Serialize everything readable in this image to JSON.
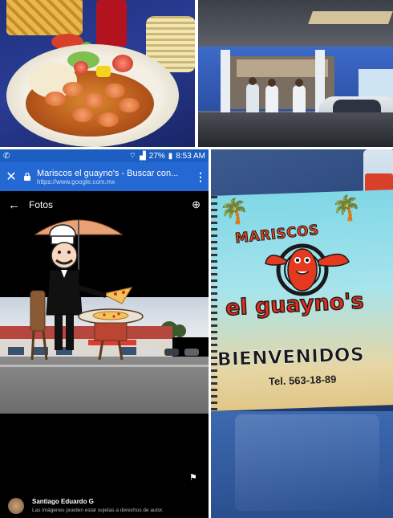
{
  "phone": {
    "status_left": "✆",
    "battery": "27%",
    "time": "8:53 AM",
    "close_icon": "close-icon",
    "page_title": "Mariscos el guayno's - Buscar con...",
    "page_url": "https://www.google.com.mx",
    "menu_icon": "more-vert-icon",
    "photos_title": "Fotos",
    "back_icon": "arrow-back-icon",
    "add_photo_icon": "add-photo-icon",
    "user_name": "Santiago Eduardo G",
    "copyright": "Las imágenes pueden estar sujetas a derechos de autor.",
    "flag_icon": "flag-icon"
  },
  "menu": {
    "brand_top": "MARISCOS",
    "brand_main": "el guayno's",
    "welcome": "BIENVENIDOS",
    "phone": "Tel. 563-18-89"
  },
  "colors": {
    "chrome_blue": "#2368d3",
    "status_blue": "#1d5ec2",
    "brand_red": "#e62c1a"
  }
}
